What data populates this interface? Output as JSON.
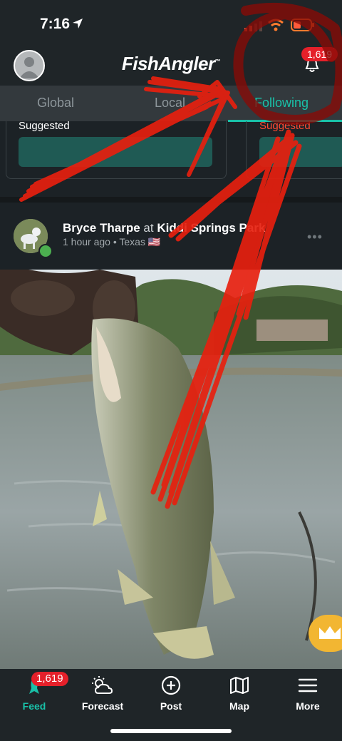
{
  "status_bar": {
    "time": "7:16"
  },
  "header": {
    "logo_text": "FishAngler",
    "logo_tm": "™",
    "notification_count": "1,619"
  },
  "tabs": [
    {
      "label": "Global",
      "active": false
    },
    {
      "label": "Local",
      "active": false
    },
    {
      "label": "Following",
      "active": true
    }
  ],
  "suggested": {
    "label_left": "Suggested",
    "label_right": "Suggested"
  },
  "post": {
    "author": "Bryce Tharpe",
    "at_word": "at",
    "location": "Kiddi Springs Park",
    "time_ago": "1 hour ago",
    "separator": "•",
    "region": "Texas",
    "flag": "🇺🇸",
    "more": "•••"
  },
  "bottom_nav": {
    "feed_badge": "1,619",
    "items": [
      {
        "label": "Feed",
        "icon": "fish-icon",
        "active": true
      },
      {
        "label": "Forecast",
        "icon": "weather-icon",
        "active": false
      },
      {
        "label": "Post",
        "icon": "plus-circle-icon",
        "active": false
      },
      {
        "label": "Map",
        "icon": "map-icon",
        "active": false
      },
      {
        "label": "More",
        "icon": "hamburger-icon",
        "active": false
      }
    ]
  },
  "colors": {
    "accent": "#19c1a8",
    "badge": "#e5202a",
    "background": "#1c2226",
    "crown": "#f2b632",
    "annotation": "#e8200f"
  }
}
